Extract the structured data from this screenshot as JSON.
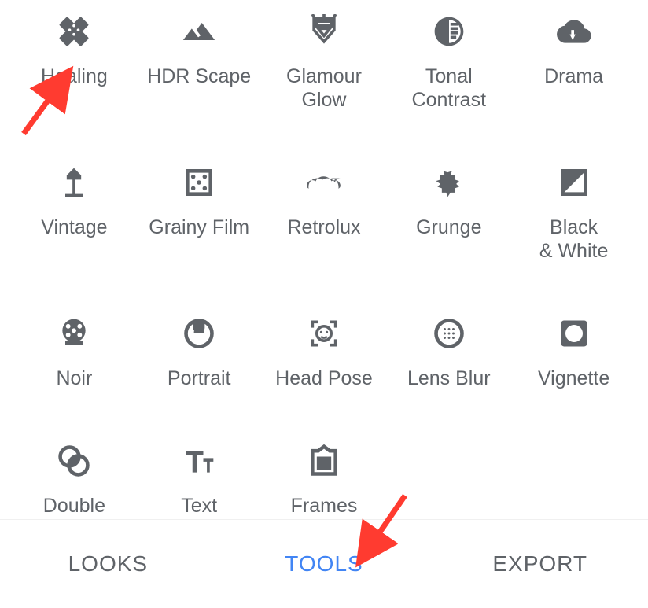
{
  "tools": [
    {
      "id": "healing",
      "label": "Healing"
    },
    {
      "id": "hdr-scape",
      "label": "HDR Scape"
    },
    {
      "id": "glamour-glow",
      "label": "Glamour\nGlow"
    },
    {
      "id": "tonal-contrast",
      "label": "Tonal\nContrast"
    },
    {
      "id": "drama",
      "label": "Drama"
    },
    {
      "id": "vintage",
      "label": "Vintage"
    },
    {
      "id": "grainy-film",
      "label": "Grainy Film"
    },
    {
      "id": "retrolux",
      "label": "Retrolux"
    },
    {
      "id": "grunge",
      "label": "Grunge"
    },
    {
      "id": "black-white",
      "label": "Black\n& White"
    },
    {
      "id": "noir",
      "label": "Noir"
    },
    {
      "id": "portrait",
      "label": "Portrait"
    },
    {
      "id": "head-pose",
      "label": "Head Pose"
    },
    {
      "id": "lens-blur",
      "label": "Lens Blur"
    },
    {
      "id": "vignette",
      "label": "Vignette"
    },
    {
      "id": "double-exposure",
      "label": "Double\nExposure"
    },
    {
      "id": "text",
      "label": "Text"
    },
    {
      "id": "frames",
      "label": "Frames"
    }
  ],
  "tabs": {
    "looks": "LOOKS",
    "tools": "TOOLS",
    "export": "EXPORT",
    "active": "tools"
  },
  "annotations": {
    "arrow1_target": "healing",
    "arrow2_target": "tools-tab"
  }
}
